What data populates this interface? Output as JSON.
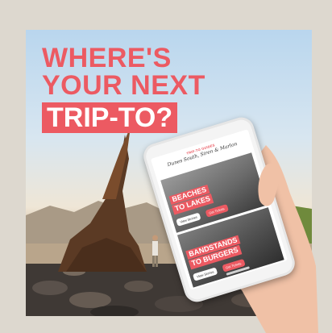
{
  "headline": {
    "line1": "WHERE'S",
    "line2": "YOUR NEXT",
    "line3": "TRIP-TO?"
  },
  "phone": {
    "kicker": "TRIP-TO GUIDES",
    "app_title": "Dunes South, Siren & Marlon",
    "cards": [
      {
        "title_line1": "BEACHES",
        "title_line2": "TO LAKES",
        "button1": "View Stories",
        "button2": "Get Tickets"
      },
      {
        "title_line1": "BANDSTANDS",
        "title_line2": "TO BURGERS",
        "button1": "View Stories",
        "button2": "Get Tickets"
      }
    ]
  },
  "colors": {
    "accent": "#ec5a62",
    "frame": "#ddd8cf",
    "sky": "#b9d6ee"
  }
}
